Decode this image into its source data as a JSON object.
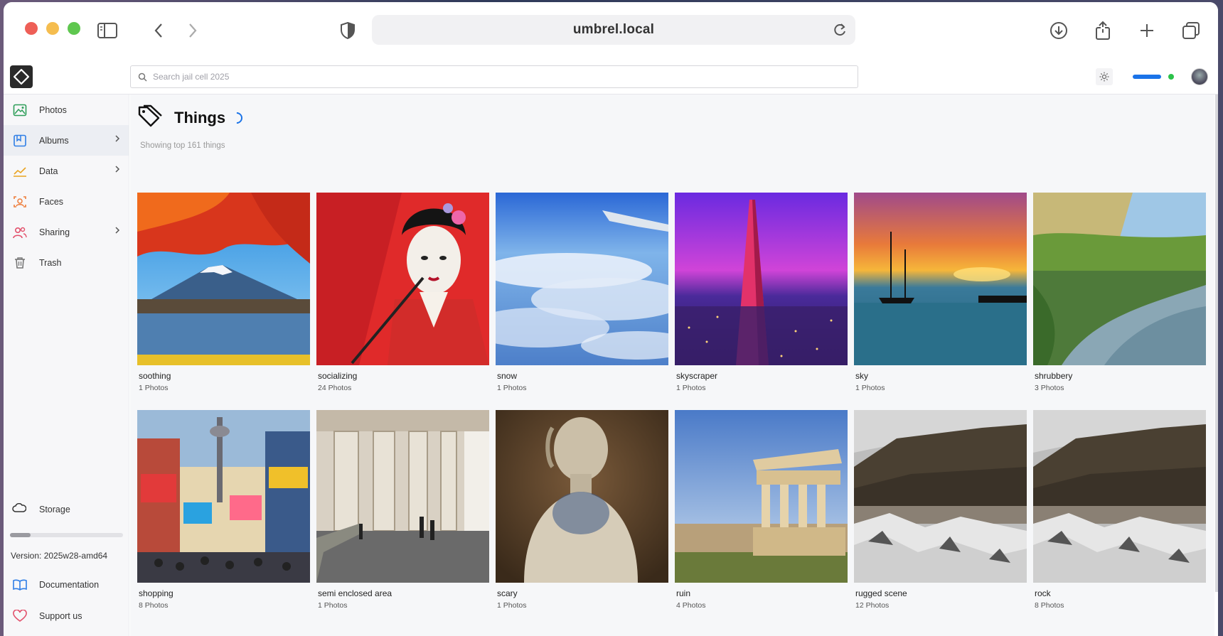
{
  "browser": {
    "url": "umbrel.local",
    "traffic_colors": [
      "#ee5f57",
      "#f5bd4f",
      "#5fc74f"
    ]
  },
  "search": {
    "placeholder": "Search jail cell 2025"
  },
  "sidebar": {
    "items": [
      {
        "label": "Photos",
        "icon": "photos-icon",
        "color": "#2e9e59",
        "chevron": false,
        "active": false
      },
      {
        "label": "Albums",
        "icon": "albums-icon",
        "color": "#2f7ee6",
        "chevron": true,
        "active": true
      },
      {
        "label": "Data",
        "icon": "chart-icon",
        "color": "#e9a321",
        "chevron": true,
        "active": false
      },
      {
        "label": "Faces",
        "icon": "faces-icon",
        "color": "#ee7d3b",
        "chevron": false,
        "active": false
      },
      {
        "label": "Sharing",
        "icon": "sharing-icon",
        "color": "#e2506b",
        "chevron": true,
        "active": false
      },
      {
        "label": "Trash",
        "icon": "trash-icon",
        "color": "#777777",
        "chevron": false,
        "active": false
      }
    ],
    "storage_label": "Storage",
    "storage_used_fraction": 0.18,
    "version": "Version: 2025w28-amd64",
    "documentation_label": "Documentation",
    "support_label": "Support us"
  },
  "main": {
    "title": "Things",
    "subtitle": "Showing top 161 things",
    "things": [
      {
        "name": "soothing",
        "count": "1 Photos",
        "scene": "fuji"
      },
      {
        "name": "socializing",
        "count": "24 Photos",
        "scene": "geisha"
      },
      {
        "name": "snow",
        "count": "1 Photos",
        "scene": "clouds"
      },
      {
        "name": "skyscraper",
        "count": "1 Photos",
        "scene": "tower"
      },
      {
        "name": "sky",
        "count": "1 Photos",
        "scene": "sunset"
      },
      {
        "name": "shrubbery",
        "count": "3 Photos",
        "scene": "river"
      },
      {
        "name": "shopping",
        "count": "8 Photos",
        "scene": "street"
      },
      {
        "name": "semi enclosed area",
        "count": "1 Photos",
        "scene": "columns"
      },
      {
        "name": "scary",
        "count": "1 Photos",
        "scene": "bust"
      },
      {
        "name": "ruin",
        "count": "4 Photos",
        "scene": "ruin"
      },
      {
        "name": "rugged scene",
        "count": "12 Photos",
        "scene": "rocky"
      },
      {
        "name": "rock",
        "count": "8 Photos",
        "scene": "rocky"
      }
    ]
  }
}
